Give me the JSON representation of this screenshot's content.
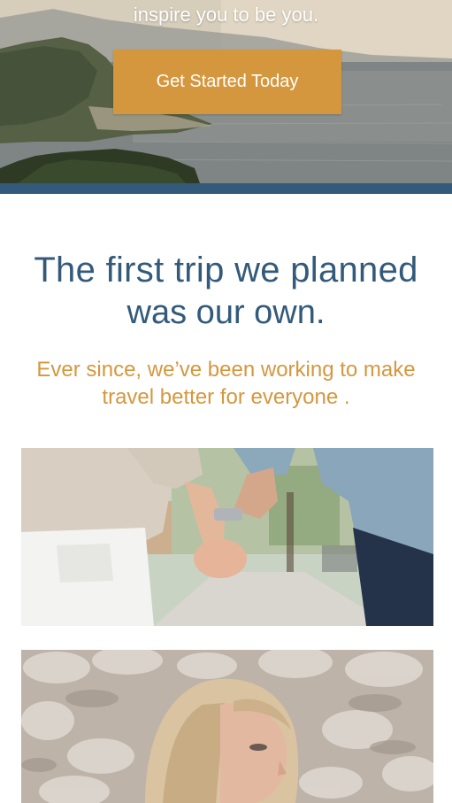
{
  "hero": {
    "partial_line": "",
    "subtitle": "inspire you to be you.",
    "cta_label": "Get Started Today"
  },
  "intro": {
    "heading_line1": "The first trip we planned",
    "heading_line2": "was our own.",
    "tagline_part1": "Ever since, we’ve been working to make travel",
    "tagline_highlight": "better for everyone",
    "tagline_end": "."
  },
  "colors": {
    "accent": "#d5973e",
    "brand_blue": "#335a7a"
  },
  "photos": [
    {
      "name": "couple-holding-hands-photo"
    },
    {
      "name": "woman-portrait-photo"
    }
  ]
}
